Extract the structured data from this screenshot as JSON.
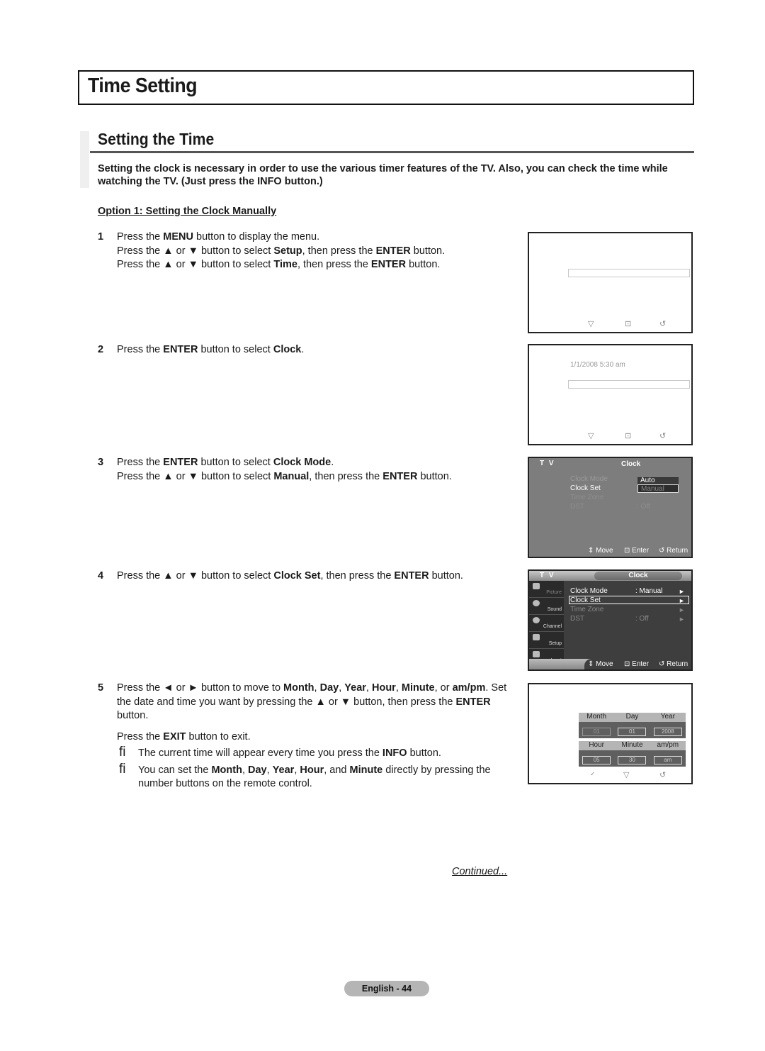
{
  "page_title": "Time Setting",
  "section_title": "Setting the Time",
  "intro": "Setting the clock is necessary in order to use the various timer features of the TV. Also, you can check the time while watching the TV. (Just press the INFO button.)",
  "option_heading": "Option 1: Setting the Clock Manually",
  "steps": [
    {
      "num": "1"
    },
    {
      "num": "2"
    },
    {
      "num": "3"
    },
    {
      "num": "4"
    },
    {
      "num": "5"
    }
  ],
  "text": {
    "press_the": "Press the ",
    "menu": "MENU",
    "display_menu": " button to display the menu.",
    "up_or_down": " ▲ or ▼ button to select ",
    "setup": "Setup",
    "then_press": ", then press the ",
    "enter": "ENTER",
    "button_dot": " button.",
    "time": "Time",
    "enter_select": " button to select ",
    "clock": "Clock",
    "clock_mode": "Clock Mode",
    "manual": "Manual",
    "clock_set": "Clock Set",
    "dot": ".",
    "step5_a": " ◄ or ► button to move to ",
    "month": "Month",
    "day": "Day",
    "year": "Year",
    "hour": "Hour",
    "minute": "Minute",
    "ampm_a": "am/",
    "ampm_b": "pm",
    "comma": ", ",
    "or": ", or ",
    "step5_b": ". Set the date and time you want by pressing the ▲ or ▼ button, then press the ",
    "exit_pre": "Press the ",
    "exit": "EXIT",
    "exit_post": " button to exit.",
    "note_symbol": "fi",
    "note1_a": "The current time will appear every time you press the ",
    "info": "INFO",
    "note1_b": " button.",
    "note2_a": "You can set the ",
    "and": ", and ",
    "note2_b": " directly by pressing the number buttons on the remote control."
  },
  "screens": {
    "screen2": {
      "date_time": "1/1/2008   5:30 am"
    },
    "screen3": {
      "tv_label": "T V",
      "header": "Clock",
      "items": [
        "Clock Mode",
        "Clock Set",
        "Time Zone",
        "DST"
      ],
      "dst_value": ": Off",
      "colon": ":",
      "popup_options": [
        "Auto",
        "Manual"
      ],
      "footer": {
        "move": "⇕ Move",
        "enter": "⊡ Enter",
        "return": "↺ Return"
      }
    },
    "screen4": {
      "tv_label": "T V",
      "header": "Clock",
      "sidebar": [
        "Picture",
        "Sound",
        "Channel",
        "Setup",
        "Input"
      ],
      "items": [
        {
          "label": "Clock Mode",
          "value": ": Manual"
        },
        {
          "label": "Clock Set",
          "value": ""
        },
        {
          "label": "Time Zone",
          "value": ""
        },
        {
          "label": "DST",
          "value": ": Off"
        }
      ],
      "arrow": "►",
      "footer": {
        "move": "⇕ Move",
        "enter": "⊡ Enter",
        "return": "↺ Return"
      }
    },
    "screen5": {
      "date_headers": [
        "Month",
        "Day",
        "Year"
      ],
      "date_values": [
        "01",
        "01",
        "2008"
      ],
      "time_headers": [
        "Hour",
        "Minute",
        "am/pm"
      ],
      "time_values": [
        "05",
        "30",
        "am"
      ]
    },
    "icons": {
      "down": "▽",
      "enter": "⊡",
      "return": "↺",
      "check": "✓"
    }
  },
  "continued": "Continued...",
  "page_number": "English - 44"
}
